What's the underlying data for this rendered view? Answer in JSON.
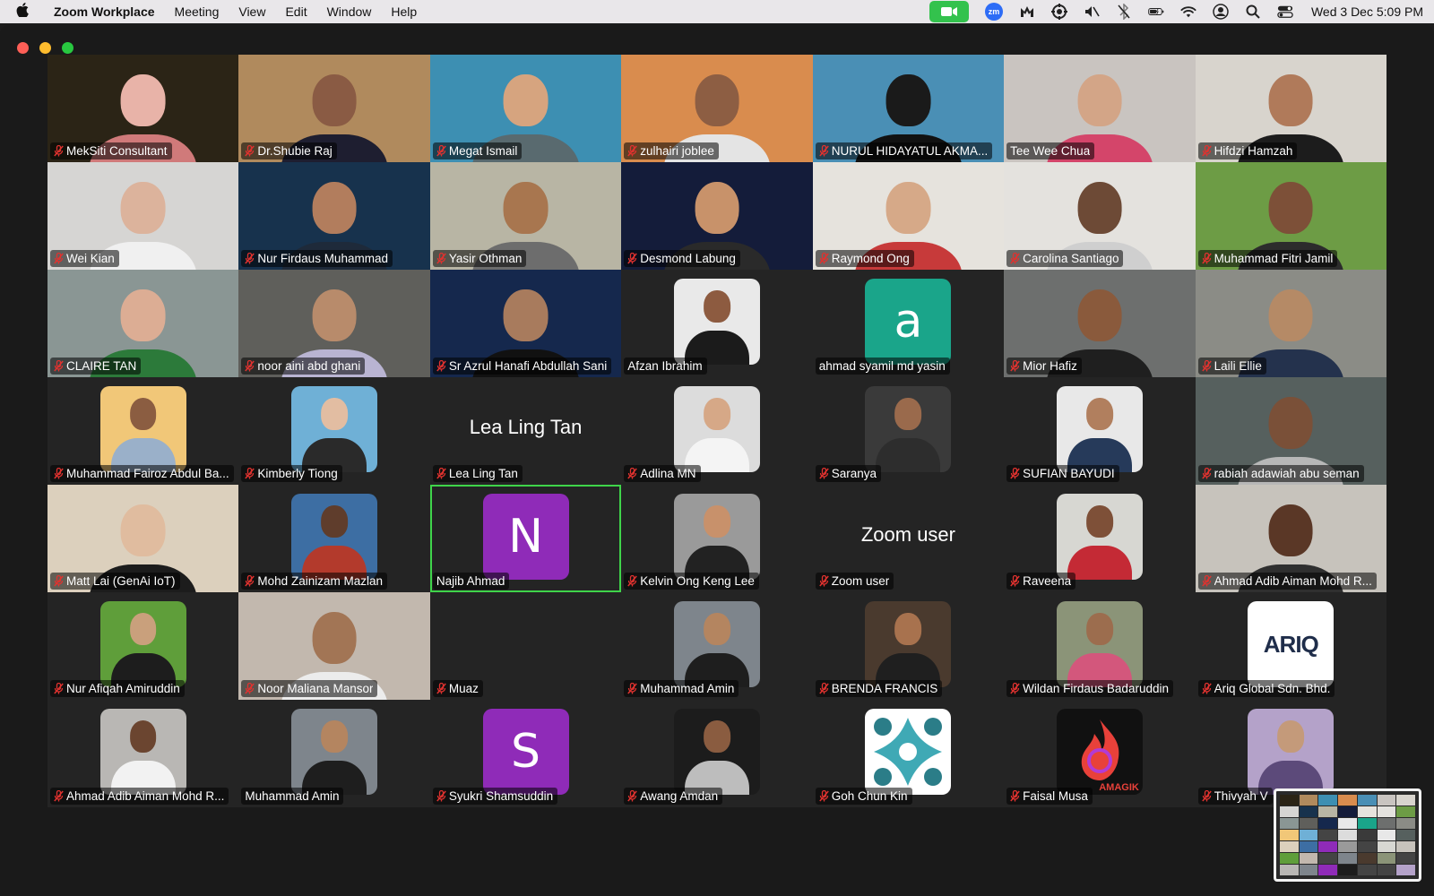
{
  "menubar": {
    "app_name": "Zoom Workplace",
    "menus": [
      "Meeting",
      "View",
      "Edit",
      "Window",
      "Help"
    ],
    "status_icons": [
      "zoom-video-icon",
      "zoom-zm-icon",
      "malwarebytes-icon",
      "settings-icon",
      "mute-speaker-icon",
      "bluetooth-off-icon",
      "battery-icon",
      "wifi-icon",
      "user-icon",
      "search-icon",
      "control-center-icon"
    ],
    "zm_text": "zm",
    "clock": "Wed 3 Dec  5:09 PM"
  },
  "colors": {
    "active_speaker_border": "#3fd44a",
    "mute_red": "#e0322f",
    "tile_bg": "#242424"
  },
  "participants": [
    {
      "name": "MekSiti Consultant",
      "muted": true,
      "type": "video",
      "bg": "#2b2416",
      "skin": "#e8b3a8",
      "shirt": "#d07a7a"
    },
    {
      "name": "Dr.Shubie Raj",
      "muted": true,
      "type": "video",
      "bg": "#b08a5d",
      "skin": "#8a5b44",
      "shirt": "#1e1e30"
    },
    {
      "name": "Megat Ismail",
      "muted": true,
      "type": "video",
      "bg": "#3d8fb2",
      "skin": "#d6a47f",
      "shirt": "#596a6f"
    },
    {
      "name": "zulhairi joblee",
      "muted": true,
      "type": "video",
      "bg": "#d98c4e",
      "skin": "#8d5e43",
      "shirt": "#e4e4e4"
    },
    {
      "name": "NURUL HIDAYATUL AKMA...",
      "muted": true,
      "type": "video",
      "bg": "#4a8fb5",
      "skin": "#1a1a1a",
      "shirt": "#111111"
    },
    {
      "name": "Tee Wee Chua",
      "muted": false,
      "type": "video",
      "bg": "#c9c4c0",
      "skin": "#d3a587",
      "shirt": "#d4456a"
    },
    {
      "name": "Hifdzi Hamzah",
      "muted": true,
      "type": "video",
      "bg": "#d8d4cd",
      "skin": "#b07a5a",
      "shirt": "#1c1c1c"
    },
    {
      "name": "Wei Kian",
      "muted": true,
      "type": "video",
      "bg": "#d6d5d3",
      "skin": "#dcb39c",
      "shirt": "#f0f0f0"
    },
    {
      "name": "Nur Firdaus Muhammad",
      "muted": true,
      "type": "video",
      "bg": "#17324d",
      "skin": "#b27d5d",
      "shirt": "#1e2a3a"
    },
    {
      "name": "Yasir Othman",
      "muted": true,
      "type": "video",
      "bg": "#b8b5a4",
      "skin": "#a8764f",
      "shirt": "#6d6d6d"
    },
    {
      "name": "Desmond Labung",
      "muted": true,
      "type": "video",
      "bg": "#141c3a",
      "skin": "#c8926a",
      "shirt": "#2a2a2a"
    },
    {
      "name": "Raymond Ong",
      "muted": true,
      "type": "video",
      "bg": "#e6e3dd",
      "skin": "#d6a988",
      "shirt": "#c73a3a"
    },
    {
      "name": "Carolina Santiago",
      "muted": true,
      "type": "video",
      "bg": "#e4e2de",
      "skin": "#6d4a36",
      "shirt": "#cfcfcf"
    },
    {
      "name": "Muhammad Fitri Jamil",
      "muted": true,
      "type": "video",
      "bg": "#6d9c45",
      "skin": "#7d5038",
      "shirt": "#2c2c2c"
    },
    {
      "name": "CLAIRE TAN",
      "muted": true,
      "type": "video",
      "bg": "#8a9694",
      "skin": "#dcad94",
      "shirt": "#2c7a3a"
    },
    {
      "name": "noor aini abd ghani",
      "muted": true,
      "type": "video",
      "bg": "#5f5f5b",
      "skin": "#b88b6b",
      "shirt": "#b9b4d2"
    },
    {
      "name": "Sr Azrul Hanafi Abdullah Sani",
      "muted": true,
      "type": "video",
      "bg": "#15284d",
      "skin": "#a87b5d",
      "shirt": "#111111"
    },
    {
      "name": "Afzan Ibrahim",
      "muted": false,
      "type": "picture",
      "bg": "#e9e9e9",
      "skin": "#8d5b40",
      "shirt": "#1b1b1b"
    },
    {
      "name": "ahmad syamil md yasin",
      "muted": false,
      "type": "letter",
      "letter": "a",
      "avatar_color": "#1aa58a"
    },
    {
      "name": "Mior Hafiz",
      "muted": true,
      "type": "video",
      "bg": "#6d6f6e",
      "skin": "#8a5a3c",
      "shirt": "#1f1f1f"
    },
    {
      "name": "Laili Ellie",
      "muted": true,
      "type": "video",
      "bg": "#8b8c86",
      "skin": "#b58a66",
      "shirt": "#24324d"
    },
    {
      "name": "Muhammad Fairoz Abdul Ba...",
      "muted": true,
      "type": "picture",
      "bg": "#f1c778",
      "skin": "#8b5d41",
      "shirt": "#9ab0c9"
    },
    {
      "name": "Kimberly Tiong",
      "muted": true,
      "type": "picture",
      "bg": "#6fb0d6",
      "skin": "#e2bda2",
      "shirt": "#2a2a2a"
    },
    {
      "name": "Lea Ling Tan",
      "muted": true,
      "type": "name",
      "display": "Lea Ling Tan"
    },
    {
      "name": "Adlina MN",
      "muted": true,
      "type": "picture",
      "bg": "#dcdcdc",
      "skin": "#d6a887",
      "shirt": "#f4f4f4"
    },
    {
      "name": "Saranya",
      "muted": true,
      "type": "picture",
      "bg": "#3a3a3a",
      "skin": "#9a6a4c",
      "shirt": "#2d2d2d"
    },
    {
      "name": "SUFIAN BAYUDI",
      "muted": true,
      "type": "picture",
      "bg": "#e8e8e8",
      "skin": "#b17f5e",
      "shirt": "#263a5a"
    },
    {
      "name": "rabiah adawiah abu seman",
      "muted": true,
      "type": "video",
      "bg": "#56605e",
      "skin": "#7a5038",
      "shirt": "#b7b7b7"
    },
    {
      "name": "Matt Lai (GenAi IoT)",
      "muted": true,
      "type": "video",
      "bg": "#dcd0bd",
      "skin": "#e0bc9f",
      "shirt": "#1c1c1c"
    },
    {
      "name": "Mohd Zainizam Mazlan",
      "muted": true,
      "type": "picture",
      "bg": "#3d6ea3",
      "skin": "#5f3d2c",
      "shirt": "#b33a2c"
    },
    {
      "name": "Najib Ahmad",
      "muted": false,
      "type": "letter",
      "letter": "N",
      "avatar_color": "#8f2bb8",
      "active": true
    },
    {
      "name": "Kelvin Ong Keng Lee",
      "muted": true,
      "type": "picture",
      "bg": "#9a9a9a",
      "skin": "#c8916b",
      "shirt": "#222222"
    },
    {
      "name": "Zoom user",
      "muted": true,
      "type": "name",
      "display": "Zoom user"
    },
    {
      "name": "Raveena",
      "muted": true,
      "type": "picture",
      "bg": "#d7d7d2",
      "skin": "#7e5038",
      "shirt": "#c42a35"
    },
    {
      "name": "Ahmad Adib Aiman Mohd R...",
      "muted": true,
      "type": "video",
      "bg": "#c7c3bc",
      "skin": "#5a3726",
      "shirt": "#2f2f2f"
    },
    {
      "name": "Nur Afiqah Amiruddin",
      "muted": true,
      "type": "picture",
      "bg": "#5f9e3a",
      "skin": "#c9a07c",
      "shirt": "#1d1d1d"
    },
    {
      "name": "Noor Maliana Mansor",
      "muted": true,
      "type": "video",
      "bg": "#c2b8ae",
      "skin": "#a27555",
      "shirt": "#ececec"
    },
    {
      "name": "Muaz",
      "muted": true,
      "type": "empty"
    },
    {
      "name": "Muhammad Amin",
      "muted": true,
      "type": "picture",
      "bg": "#7e858c",
      "skin": "#b48560",
      "shirt": "#1e1e1e"
    },
    {
      "name": "BRENDA FRANCIS",
      "muted": true,
      "type": "picture",
      "bg": "#4a3a2e",
      "skin": "#a8724e",
      "shirt": "#1f1f1f"
    },
    {
      "name": "Wildan Firdaus Badaruddin",
      "muted": true,
      "type": "picture",
      "bg": "#8b9478",
      "skin": "#9c6d4e",
      "shirt": "#d3577c"
    },
    {
      "name": "Ariq Global Sdn. Bhd.",
      "muted": true,
      "type": "logo",
      "logo_text": "ARIQ"
    },
    {
      "name": "Ahmad Adib Aiman Mohd R...",
      "muted": true,
      "type": "picture",
      "bg": "#b9b7b4",
      "skin": "#6b4530",
      "shirt": "#f2f2f2"
    },
    {
      "name": "Muhammad Amin",
      "muted": false,
      "type": "picture",
      "bg": "#7e858c",
      "skin": "#b48560",
      "shirt": "#1e1e1e"
    },
    {
      "name": "Syukri Shamsuddin",
      "muted": true,
      "type": "letter",
      "letter": "S",
      "avatar_color": "#8f2bb8"
    },
    {
      "name": "Awang Amdan",
      "muted": true,
      "type": "picture",
      "bg": "#1c1c1c",
      "skin": "#8a5c40",
      "shirt": "#bdbdbd"
    },
    {
      "name": "Goh Chun Kin",
      "muted": true,
      "type": "mark",
      "mark": "teal-star"
    },
    {
      "name": "Faisal Musa",
      "muted": true,
      "type": "mark",
      "mark": "flame",
      "logo_text": "AMAGIK"
    },
    {
      "name": "Thivyah V",
      "muted": true,
      "type": "picture",
      "bg": "#b4a2c9",
      "skin": "#c49a7a",
      "shirt": "#5c4a7a"
    }
  ]
}
